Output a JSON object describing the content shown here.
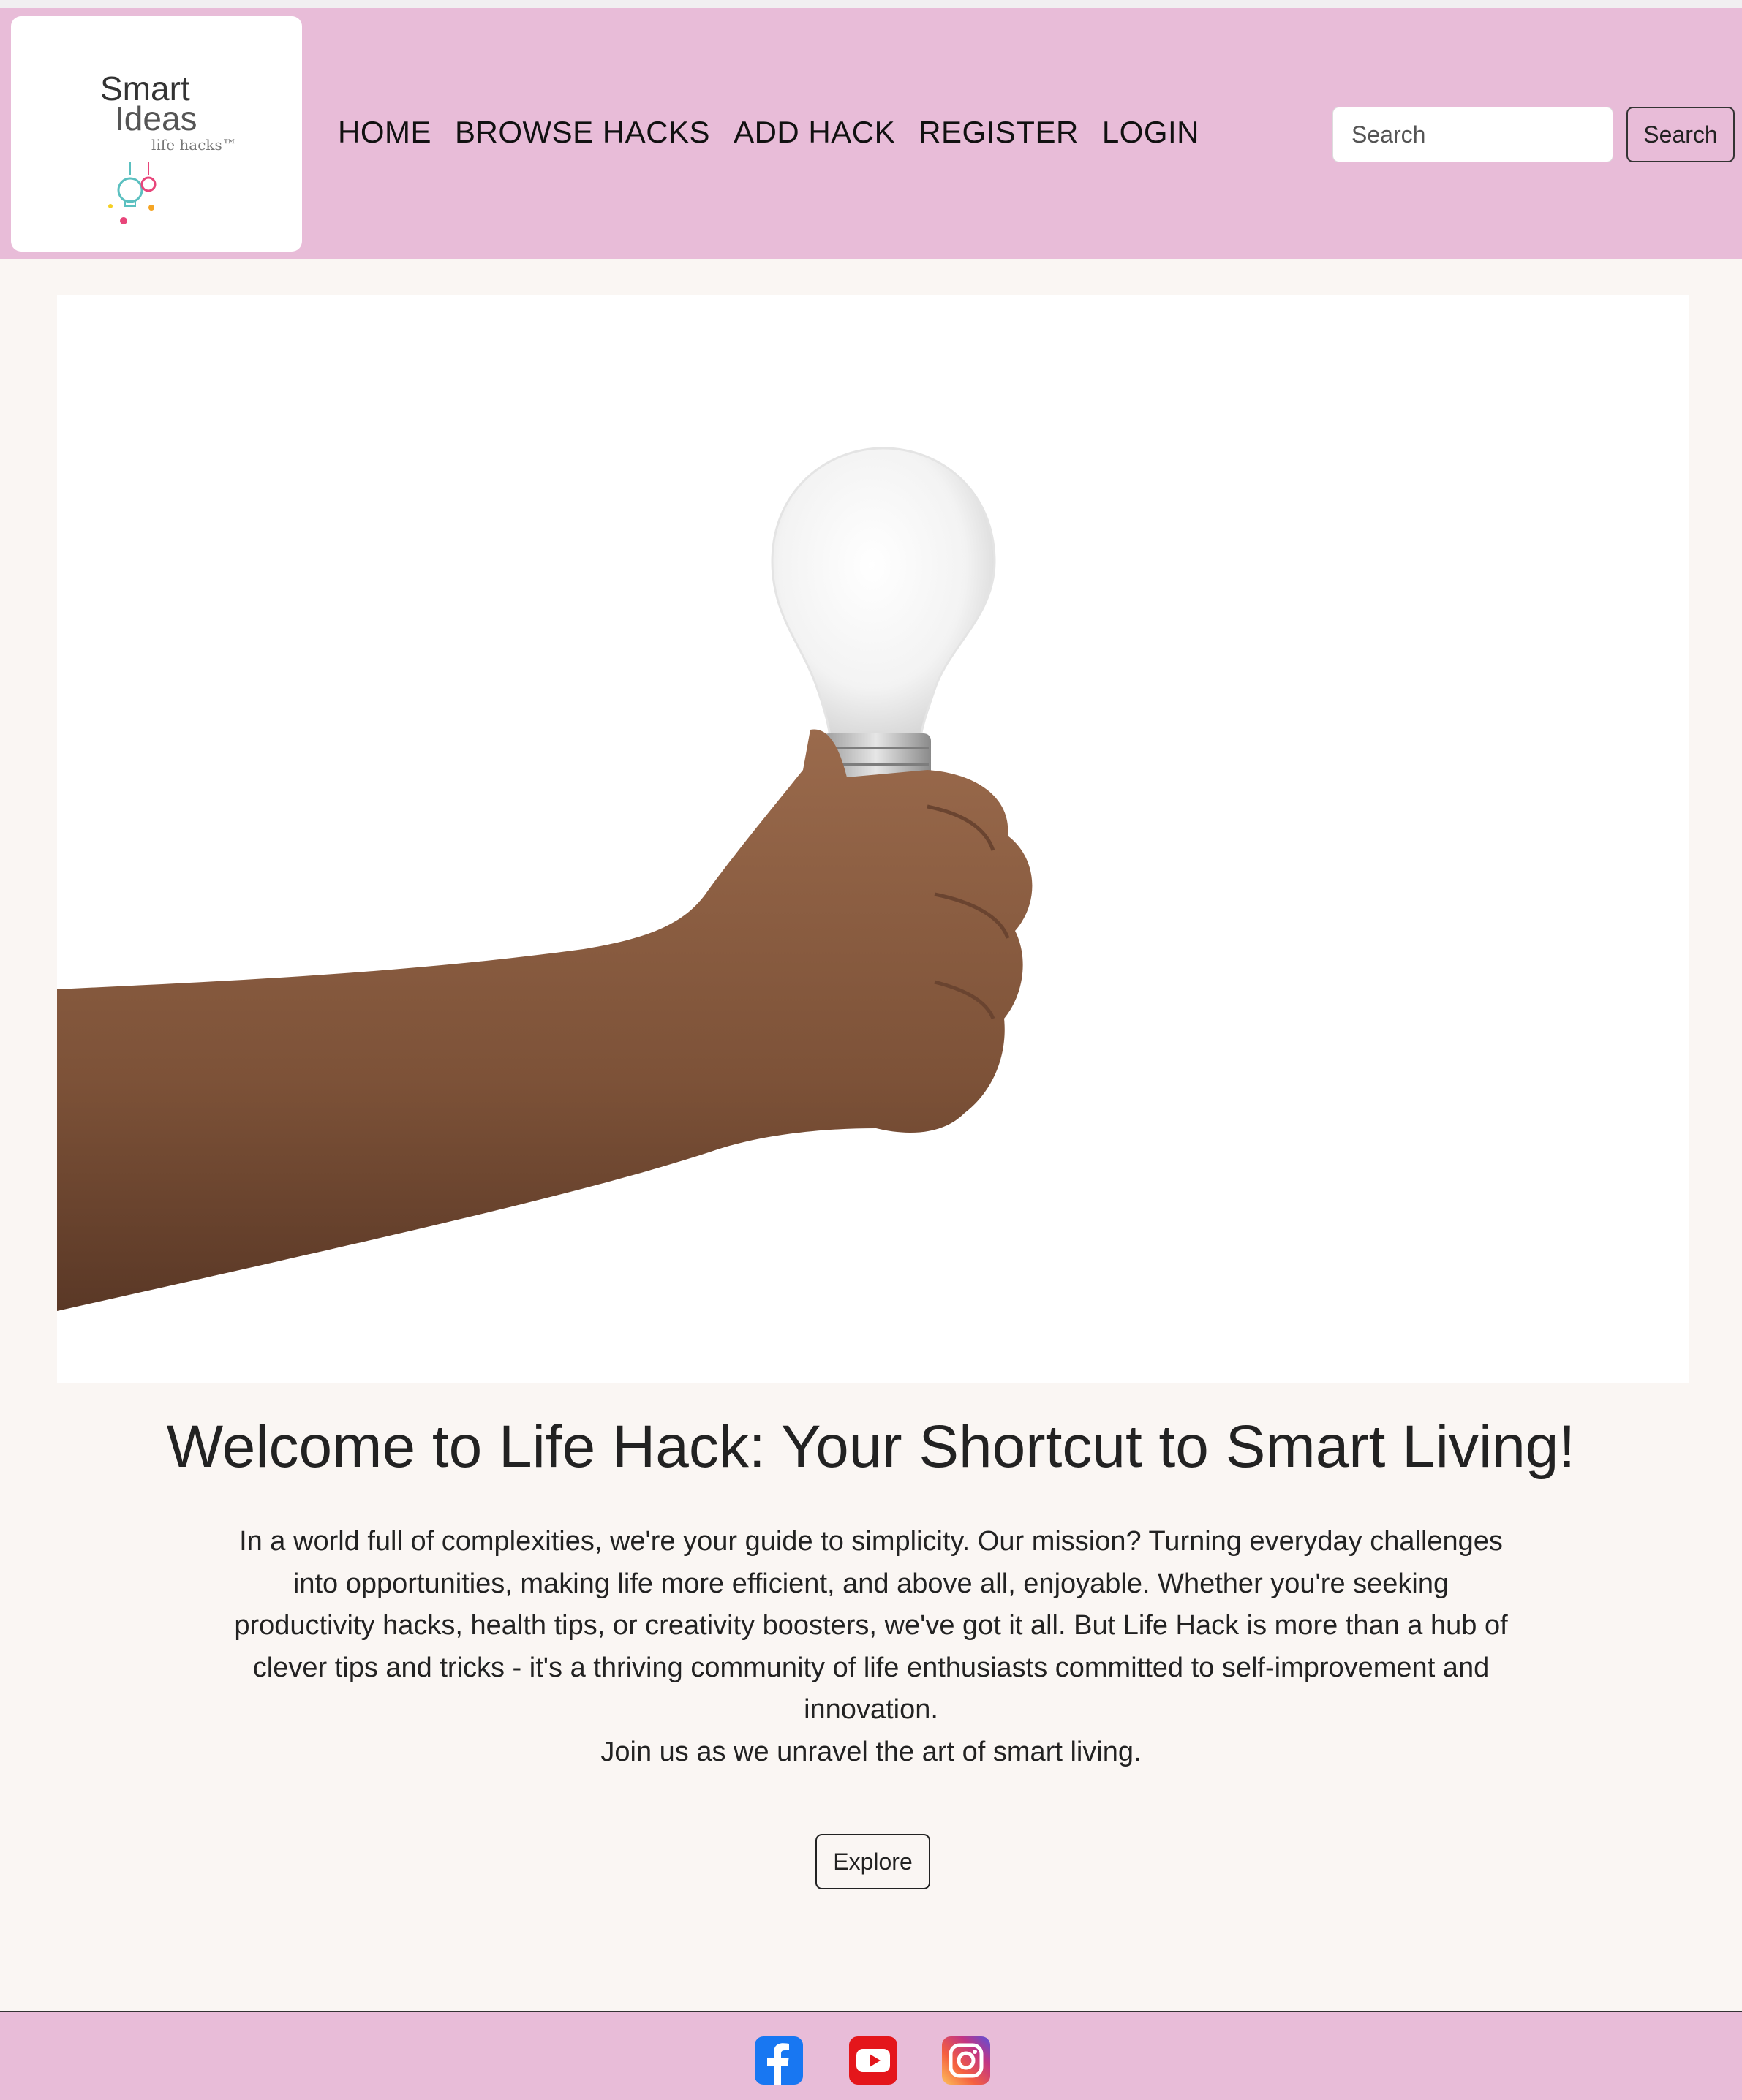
{
  "logo": {
    "line1": "Smart",
    "line2": "Ideas",
    "tagline": "life hacks™",
    "icon": "lightbulbs-logo-icon"
  },
  "nav": {
    "items": [
      {
        "label": "HOME"
      },
      {
        "label": "BROWSE HACKS"
      },
      {
        "label": "ADD HACK"
      },
      {
        "label": "REGISTER"
      },
      {
        "label": "LOGIN"
      }
    ]
  },
  "search": {
    "placeholder": "Search",
    "button_label": "Search"
  },
  "hero": {
    "image": "hand-holding-lightbulb-image"
  },
  "main": {
    "title": "Welcome to Life Hack: Your Shortcut to Smart Living!",
    "paragraph": "In a world full of complexities, we're your guide to simplicity. Our mission? Turning everyday challenges into opportunities, making life more efficient, and above all, enjoyable. Whether you're seeking productivity hacks, health tips, or creativity boosters, we've got it all. But Life Hack is more than a hub of clever tips and tricks - it's a thriving community of life enthusiasts committed to self-improvement and innovation.",
    "paragraph2": "Join us as we unravel the art of smart living.",
    "explore_label": "Explore"
  },
  "footer": {
    "social": [
      {
        "name": "facebook-icon",
        "color": "#1877f2"
      },
      {
        "name": "youtube-icon",
        "color": "#e4161b"
      },
      {
        "name": "instagram-icon",
        "color": "#c13584"
      }
    ]
  },
  "colors": {
    "header_bg": "#e8bcd8",
    "page_bg": "#faf6f3"
  }
}
